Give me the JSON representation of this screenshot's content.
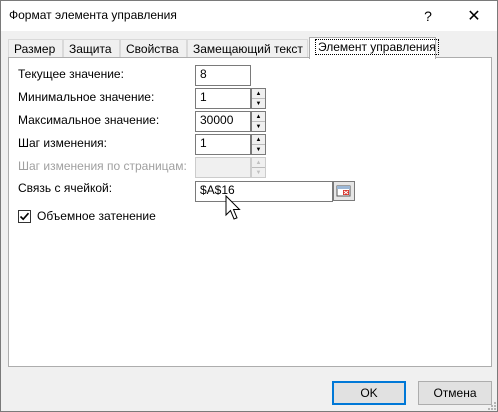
{
  "window": {
    "title": "Формат элемента управления",
    "help_label": "?",
    "close_label": "✕"
  },
  "tabs": [
    {
      "label": "Размер"
    },
    {
      "label": "Защита"
    },
    {
      "label": "Свойства"
    },
    {
      "label": "Замещающий текст"
    },
    {
      "label": "Элемент управления",
      "active": true
    }
  ],
  "form": {
    "current_value": {
      "label": "Текущее значение:",
      "value": "8"
    },
    "min_value": {
      "label": "Минимальное значение:",
      "value": "1"
    },
    "max_value": {
      "label": "Максимальное значение:",
      "value": "30000"
    },
    "step": {
      "label": "Шаг изменения:",
      "value": "1"
    },
    "page_step": {
      "label": "Шаг изменения по страницам:",
      "value": "",
      "disabled": true
    },
    "cell_link": {
      "label": "Связь с ячейкой:",
      "value": "$A$16"
    },
    "shading": {
      "label": "Объемное затенение",
      "checked": true
    }
  },
  "buttons": {
    "ok_label": "OK",
    "cancel_label": "Отмена"
  },
  "colors": {
    "accent": "#0078d7",
    "panel_bg": "#ffffff",
    "dialog_bg": "#f0f0f0",
    "ref_icon_red": "#d9352c"
  }
}
